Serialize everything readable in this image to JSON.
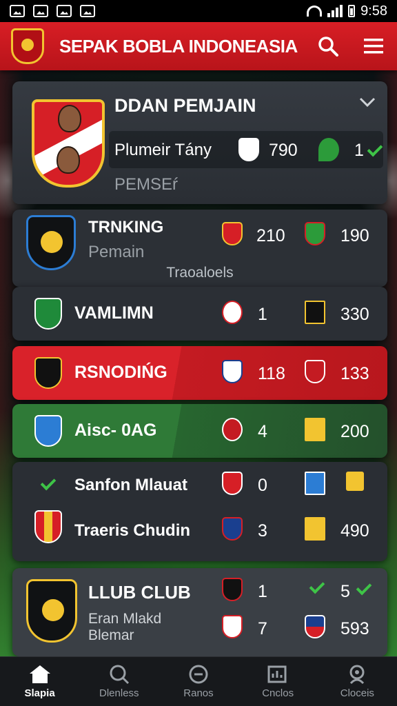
{
  "status_bar": {
    "time": "9:58"
  },
  "app_bar": {
    "title": "SEPAK BOBLA INDONEASIA"
  },
  "header": {
    "title": "DDAN PEMJAIN",
    "row_label": "Plumeir Tány",
    "value_1": "790",
    "value_2": "1",
    "subtitle": "PEMSEŕ"
  },
  "ranking": {
    "title": "TRNKING",
    "subtitle": "Pemain",
    "value_1": "210",
    "value_2": "190"
  },
  "tracked_label": "Traoaloels",
  "rows": [
    {
      "name": "VAMLIMN",
      "value_1": "1",
      "value_2": "330"
    },
    {
      "name": "RSNODIŃG",
      "value_1": "118",
      "value_2": "133"
    },
    {
      "name": "Aisc- 0AG",
      "value_1": "4",
      "value_2": "200"
    }
  ],
  "double": [
    {
      "name": "Sanfon Mlauat",
      "value_1": "0",
      "value_2": ""
    },
    {
      "name": "Traeris Chudin",
      "value_1": "3",
      "value_2": "490"
    }
  ],
  "club": {
    "title": "LLUB CLUB",
    "sub_1": "Eran Mlakd",
    "sub_2": "Blemar",
    "row_1": {
      "value_1": "1",
      "value_2": "5"
    },
    "row_2": {
      "value_1": "7",
      "value_2": "593"
    }
  },
  "nav": [
    {
      "label": "Slapia",
      "icon": "home-icon",
      "active": true
    },
    {
      "label": "Dlenless",
      "icon": "search-icon",
      "active": false
    },
    {
      "label": "Ranos",
      "icon": "ball-icon",
      "active": false
    },
    {
      "label": "Cnclos",
      "icon": "stats-icon",
      "active": false
    },
    {
      "label": "Cloceis",
      "icon": "profile-icon",
      "active": false
    }
  ],
  "colors": {
    "accent_red": "#d81e25",
    "accent_gold": "#f2c430",
    "accent_green": "#3ec447"
  }
}
